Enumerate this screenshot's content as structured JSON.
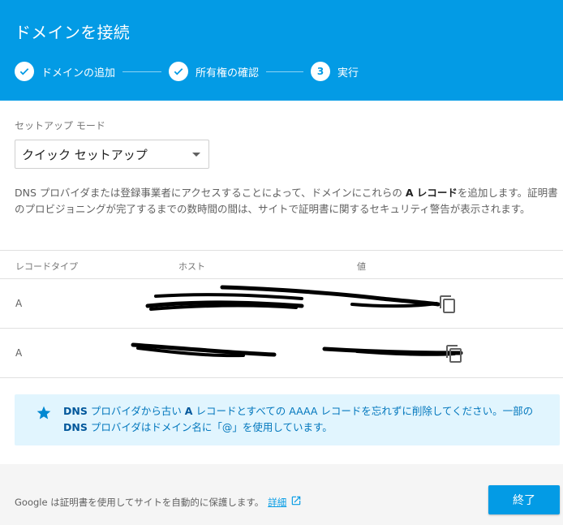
{
  "header": {
    "title": "ドメインを接続",
    "steps": [
      {
        "label": "ドメインの追加",
        "state": "done"
      },
      {
        "label": "所有権の確認",
        "state": "done"
      },
      {
        "label": "実行",
        "state": "current",
        "number": "3"
      }
    ]
  },
  "setup": {
    "mode_label": "セットアップ モード",
    "mode_value": "クイック セットアップ"
  },
  "description": {
    "before": "DNS プロバイダまたは登録事業者にアクセスすることによって、ドメインにこれらの ",
    "bold": "A レコード",
    "after": "を追加します。証明書のプロビジョニングが完了するまでの数時間の間は、サイトで証明書に関するセキュリティ警告が表示されます。"
  },
  "table": {
    "headers": {
      "type": "レコードタイプ",
      "host": "ホスト",
      "value": "値"
    },
    "rows": [
      {
        "type": "A"
      },
      {
        "type": "A"
      }
    ]
  },
  "info": {
    "parts": [
      {
        "text": "DNS",
        "bold": true
      },
      {
        "text": " プロバイダから古い ",
        "bold": false
      },
      {
        "text": "A",
        "bold": true
      },
      {
        "text": " レコードとすべての ",
        "bold": false
      },
      {
        "text": "AAAA",
        "bold": false
      },
      {
        "text": " レコードを忘れずに削除してください。一部の ",
        "bold": false
      },
      {
        "text": "DNS",
        "bold": true
      },
      {
        "text": " プロバイダはドメイン名に「@」を使用しています。",
        "bold": false
      }
    ]
  },
  "footer": {
    "text": "Google は証明書を使用してサイトを自動的に保護します。",
    "link": "詳細",
    "finish_label": "終了"
  },
  "colors": {
    "primary": "#039be5",
    "info_bg": "#e1f5fe",
    "info_text": "#0277bd"
  },
  "icons": {
    "step_done": "check-icon",
    "copy": "copy-icon",
    "info": "star-icon",
    "external": "open-in-new-icon"
  }
}
